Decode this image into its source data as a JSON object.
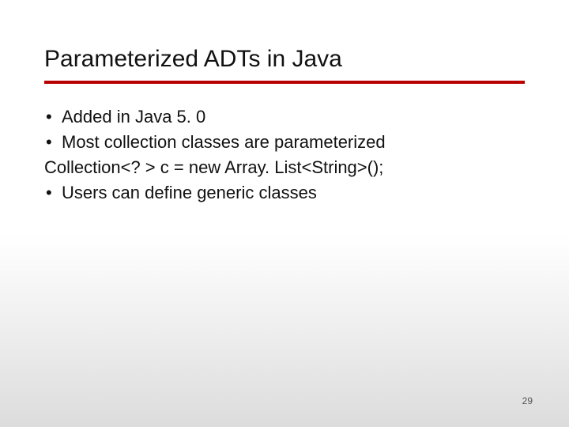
{
  "title": "Parameterized ADTs in Java",
  "lines": [
    {
      "kind": "bullet",
      "text": "Added in Java 5. 0"
    },
    {
      "kind": "bullet",
      "text": "Most collection classes are parameterized"
    },
    {
      "kind": "plain",
      "text": "Collection<? > c = new Array. List<String>();"
    },
    {
      "kind": "bullet",
      "text": "Users can define generic classes"
    }
  ],
  "bullet_glyph": "•",
  "page_number": "29",
  "accent_color": "#b80000"
}
